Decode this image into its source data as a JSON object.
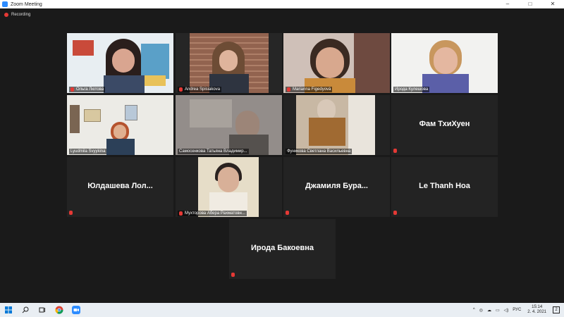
{
  "window": {
    "title": "Zoom Meeting"
  },
  "recording": {
    "label": "Recording"
  },
  "participants": [
    {
      "name": "Ольга Лютова",
      "type": "video"
    },
    {
      "name": "Andrea Spisiakova",
      "type": "video"
    },
    {
      "name": "Marianna Figedyová",
      "type": "video"
    },
    {
      "name": "Ирода Кулешова",
      "type": "video"
    },
    {
      "name": "Lyudmila Svyykina",
      "type": "video"
    },
    {
      "name": "Самосенкова Татьяна Владимир...",
      "type": "video"
    },
    {
      "name": "Фуникова Светлана Васильевна",
      "type": "video"
    },
    {
      "name": "Фам ТхиХуен",
      "type": "name-only"
    },
    {
      "name": "Юлдашева  Лол...",
      "type": "name-only"
    },
    {
      "name": "Мухторова Абера Рахматовн...",
      "type": "video"
    },
    {
      "name": "Джамиля  Бура...",
      "type": "name-only"
    },
    {
      "name": "Le Thanh Hoa",
      "type": "name-only"
    },
    {
      "name": "Ирода Бакоевна",
      "type": "name-only"
    }
  ],
  "taskbar": {
    "lang": "РУС",
    "time": "15:14",
    "date": "2. 4. 2021",
    "notifications": "2"
  },
  "colors": {
    "active_speaker": "#b5d334",
    "muted": "#e53935",
    "zoom_blue": "#2d8cff"
  }
}
